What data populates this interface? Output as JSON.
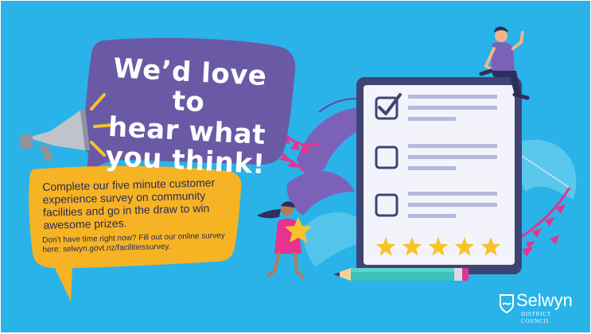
{
  "headline": {
    "lines": [
      "We’d love to",
      "hear what",
      "you think!"
    ]
  },
  "survey": {
    "body": "Complete our five minute customer experience survey on community facilities and go in the draw to win awesome prizes.",
    "note": "Don’t have time right now? Fill out our online survey here: selwyn.govt.nz/facilitiessurvey."
  },
  "rating": {
    "stars": 5,
    "max": 5
  },
  "checklist": {
    "items_checked": [
      true,
      false,
      false
    ]
  },
  "logo": {
    "name": "Selwyn",
    "sub": "DISTRICT COUNCIL"
  },
  "colors": {
    "background": "#29b3e8",
    "speech_purple": "#6a5aa6",
    "speech_yellow": "#f6b324",
    "star": "#f7c22a",
    "clipboard_frame": "#3f4475",
    "leaf_pink": "#e6338f",
    "leaf_purple": "#7b62b8"
  },
  "icons": [
    "megaphone-icon",
    "checkbox-icon",
    "star-icon",
    "pencil-icon",
    "leaf-icon",
    "logo-mark-icon"
  ]
}
